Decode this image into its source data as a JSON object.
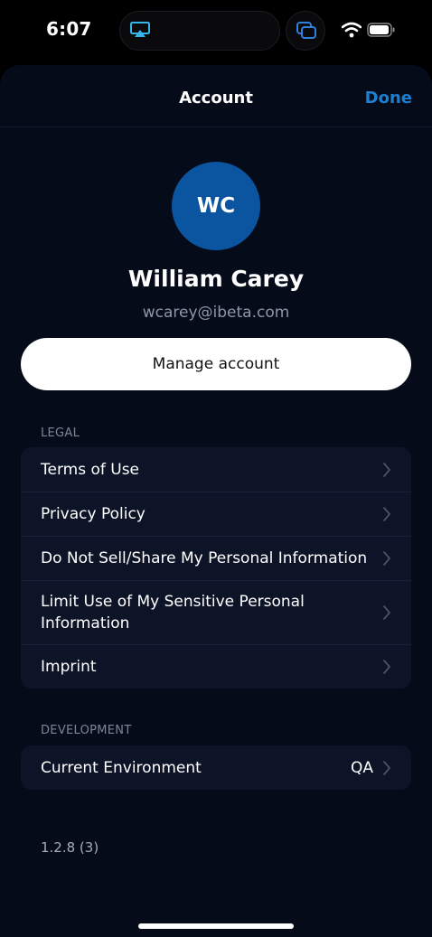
{
  "status_bar": {
    "time": "6:07",
    "icons": [
      "airplay-icon",
      "screens-icon",
      "wifi-icon",
      "battery-icon"
    ]
  },
  "nav": {
    "title": "Account",
    "done_label": "Done"
  },
  "profile": {
    "initials": "WC",
    "name": "William Carey",
    "email": "wcarey@ibeta.com",
    "avatar_color": "#0b55a0"
  },
  "manage_button_label": "Manage account",
  "legal": {
    "header": "LEGAL",
    "items": [
      {
        "label": "Terms of Use"
      },
      {
        "label": "Privacy Policy"
      },
      {
        "label": "Do Not Sell/Share My Personal Information"
      },
      {
        "label": "Limit Use of My Sensitive Personal Information"
      },
      {
        "label": "Imprint"
      }
    ]
  },
  "development": {
    "header": "DEVELOPMENT",
    "items": [
      {
        "label": "Current Environment",
        "value": "QA"
      }
    ]
  },
  "version": "1.2.8 (3)",
  "colors": {
    "accent": "#1d7fd0",
    "sheet_background": "#060b1a",
    "group_background": "#0d1427"
  }
}
